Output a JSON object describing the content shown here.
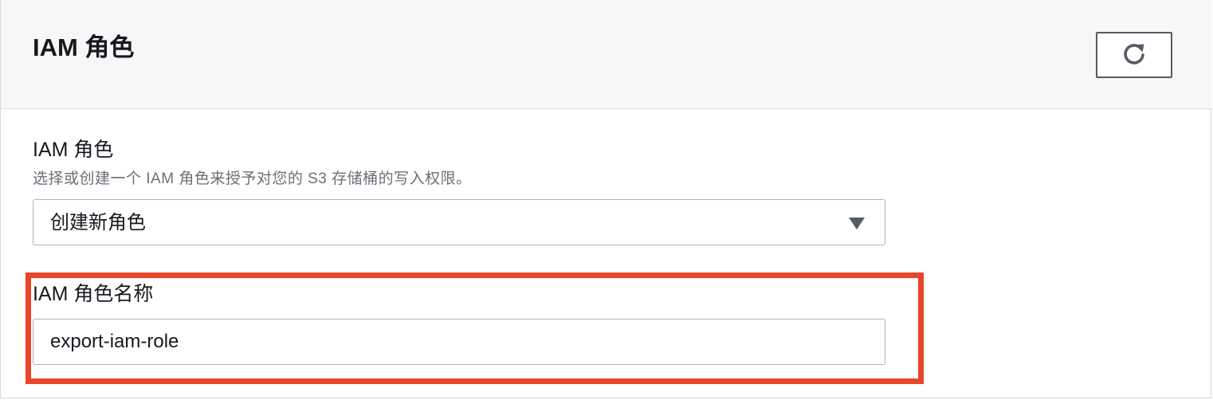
{
  "panel": {
    "title": "IAM 角色",
    "refresh_icon": "refresh-icon"
  },
  "role_select": {
    "label": "IAM 角色",
    "description": "选择或创建一个 IAM 角色来授予对您的 S3 存储桶的写入权限。",
    "selected_value": "创建新角色",
    "caret_icon": "caret-down-icon"
  },
  "role_name": {
    "label": "IAM 角色名称",
    "value": "export-iam-role"
  },
  "colors": {
    "highlight": "#e8452a",
    "header_bg": "#f7f7f7",
    "text": "#16191f",
    "secondary_text": "#687078"
  }
}
